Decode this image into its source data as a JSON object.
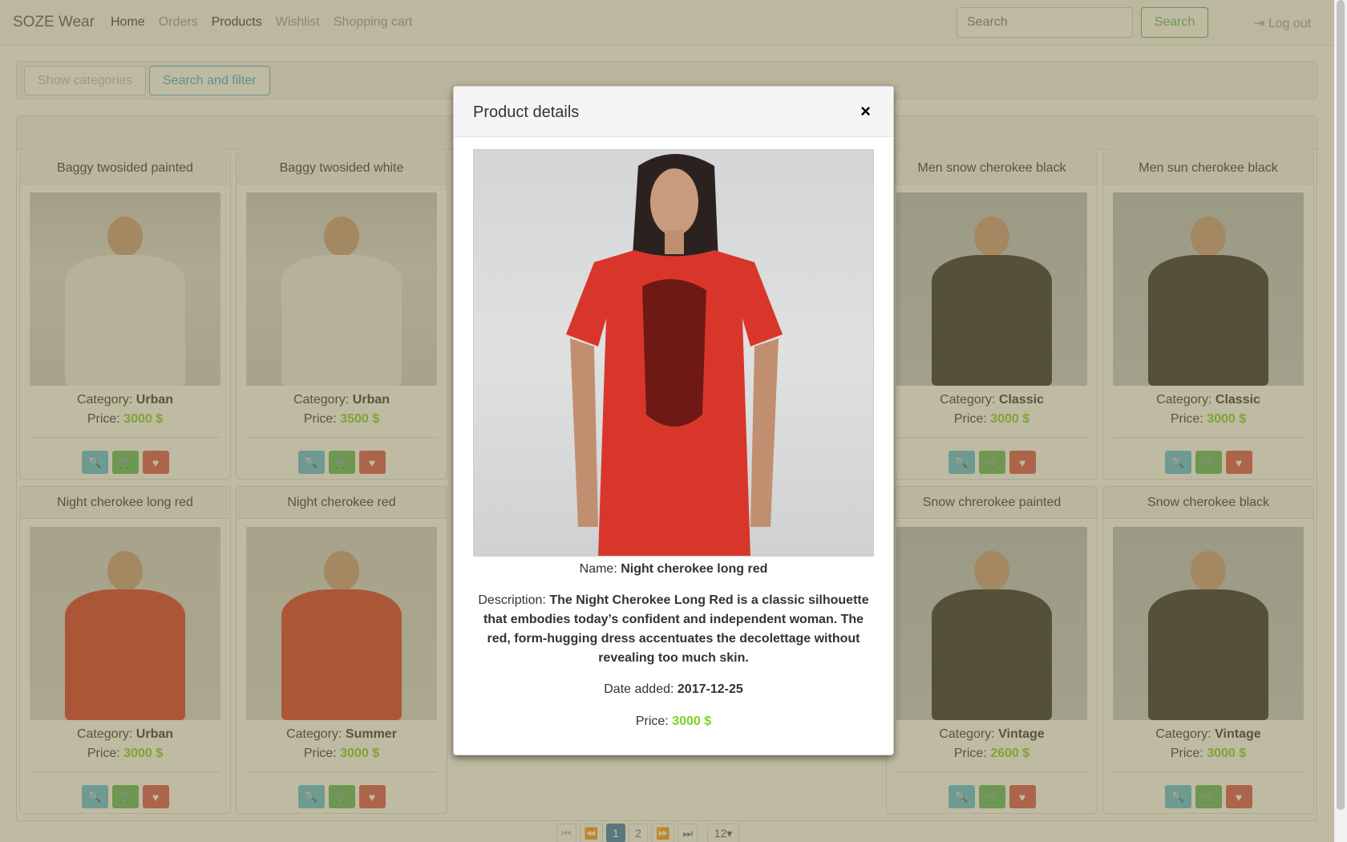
{
  "navbar": {
    "brand": "SOZE Wear",
    "links": [
      "Home",
      "Orders",
      "Products",
      "Wishlist",
      "Shopping cart"
    ],
    "search_placeholder": "Search",
    "search_button": "Search",
    "logout": "Log out"
  },
  "toolbar": {
    "show_categories": "Show categories",
    "search_and_filter": "Search and filter"
  },
  "labels": {
    "category": "Category:",
    "price": "Price:"
  },
  "products": [
    {
      "name": "Baggy twosided painted",
      "category": "Urban",
      "price": "3000 $",
      "color": "white"
    },
    {
      "name": "Baggy twosided white",
      "category": "Urban",
      "price": "3500 $",
      "color": "white"
    },
    {
      "name": "Men snow cherokee black",
      "category": "Classic",
      "price": "3000 $",
      "color": "black"
    },
    {
      "name": "Men sun cherokee black",
      "category": "Classic",
      "price": "3000 $",
      "color": "black"
    },
    {
      "name": "Night cherokee long red",
      "category": "Urban",
      "price": "3000 $",
      "color": "red"
    },
    {
      "name": "Night cherokee red",
      "category": "Summer",
      "price": "3000 $",
      "color": "red"
    },
    {
      "name": "Snow chrerokee painted",
      "category": "Vintage",
      "price": "2600 $",
      "color": "black"
    },
    {
      "name": "Snow cherokee black",
      "category": "Vintage",
      "price": "3000 $",
      "color": "black"
    }
  ],
  "pagination": {
    "pages": [
      "1",
      "2"
    ],
    "current": "1",
    "page_size": "12"
  },
  "modal": {
    "title": "Product details",
    "close": "×",
    "name_label": "Name:",
    "name": "Night cherokee long red",
    "description_label": "Description:",
    "description": "The Night Cherokee Long Red is a classic silhouette that embodies today’s confident and independent woman. The red, form-hugging dress accentuates the decolettage without revealing too much skin.",
    "date_label": "Date added:",
    "date": "2017-12-25",
    "price_label": "Price:",
    "price": "3000 $"
  },
  "colors": {
    "price_green": "#7dd321",
    "info": "#5bc0de",
    "success": "#5cb85c",
    "danger": "#d9534f",
    "backdrop": "rgba(127,118,70,0.5)"
  }
}
